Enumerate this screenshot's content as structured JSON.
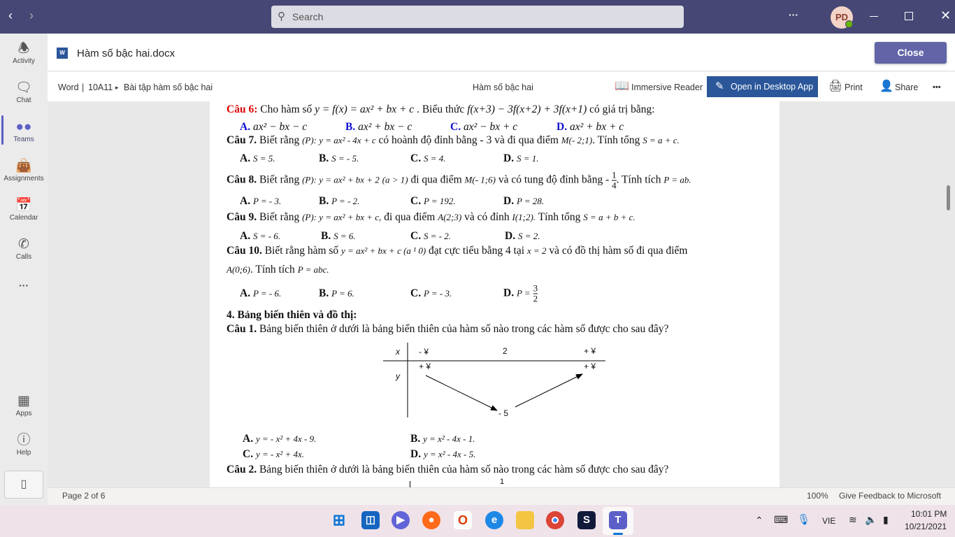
{
  "titlebar": {
    "search_placeholder": "Search",
    "more": "···",
    "avatar_initials": "PD"
  },
  "sidebar": {
    "items": [
      {
        "label": "Activity",
        "icon": "bell-icon"
      },
      {
        "label": "Chat",
        "icon": "chat-icon"
      },
      {
        "label": "Teams",
        "icon": "teams-icon",
        "active": true
      },
      {
        "label": "Assignments",
        "icon": "backpack-icon"
      },
      {
        "label": "Calendar",
        "icon": "calendar-icon"
      },
      {
        "label": "Calls",
        "icon": "phone-icon"
      },
      {
        "label": "···",
        "icon": "more-icon"
      },
      {
        "label": "Apps",
        "icon": "apps-icon"
      },
      {
        "label": "Help",
        "icon": "help-icon"
      }
    ]
  },
  "header": {
    "doc_title": "Hàm số bậc hai.docx",
    "close": "Close"
  },
  "toolbar": {
    "app": "Word",
    "sep": "|",
    "folder": "10A11",
    "arrow": "▸",
    "file": "Bài tập hàm số bậc hai",
    "center_title": "Hàm số bậc hai",
    "immersive": "Immersive Reader",
    "open_desktop": "Open in Desktop App",
    "print": "Print",
    "share": "Share",
    "more": "•••"
  },
  "doc": {
    "q6": {
      "label": "Câu 6:",
      "text1": "Cho hàm số",
      "expr1": "y = f(x) = ax² + bx + c",
      "text2": ". Biểu thức",
      "expr2": "f(x+3) − 3f(x+2) + 3f(x+1)",
      "text3": "có giá trị bằng:"
    },
    "q6_answers": [
      {
        "k": "A.",
        "v": "ax² − bx − c"
      },
      {
        "k": "B.",
        "v": "ax² + bx − c"
      },
      {
        "k": "C.",
        "v": "ax² − bx + c"
      },
      {
        "k": "D.",
        "v": "ax² + bx + c"
      }
    ],
    "q7": {
      "label": "Câu 7.",
      "text1": "Biết rằng",
      "expr1": "(P): y = ax² - 4x + c",
      "text2": "có hoành độ đỉnh bằng - 3 và đi qua điểm",
      "expr2": "M(- 2;1)",
      "text3": ". Tính tổng",
      "expr3": "S = a + c."
    },
    "q7_answers": [
      {
        "k": "A.",
        "v": "S = 5."
      },
      {
        "k": "B.",
        "v": "S = - 5."
      },
      {
        "k": "C.",
        "v": "S = 4."
      },
      {
        "k": "D.",
        "v": "S = 1."
      }
    ],
    "q8": {
      "label": "Câu 8.",
      "text1": "Biết rằng",
      "expr1": "(P): y = ax² + bx + 2",
      "expr2": "(a > 1)",
      "text2": "đi qua điểm",
      "expr3": "M(- 1;6)",
      "text3": "và có tung độ đỉnh bằng -",
      "frac_num": "1",
      "frac_den": "4",
      "text4": ". Tính tích",
      "expr4": "P = ab."
    },
    "q8_answers": [
      {
        "k": "A.",
        "v": "P = - 3."
      },
      {
        "k": "B.",
        "v": "P = - 2."
      },
      {
        "k": "C.",
        "v": "P = 192."
      },
      {
        "k": "D.",
        "v": "P = 28."
      }
    ],
    "q9": {
      "label": "Câu 9.",
      "text1": "Biết rằng",
      "expr1": "(P): y = ax² + bx + c,",
      "text2": "đi qua điểm",
      "expr2": "A(2;3)",
      "text3": "và có đỉnh",
      "expr3": "I(1;2).",
      "text4": "Tính tổng",
      "expr4": "S = a + b + c."
    },
    "q9_answers": [
      {
        "k": "A.",
        "v": "S = - 6."
      },
      {
        "k": "B.",
        "v": "S = 6."
      },
      {
        "k": "C.",
        "v": "S = - 2."
      },
      {
        "k": "D.",
        "v": "S = 2."
      }
    ],
    "q10": {
      "label": "Câu 10.",
      "text1": "Biết rằng hàm số",
      "expr1": "y = ax² + bx + c  (a ¹ 0)",
      "text2": "đạt cực tiểu bằng 4  tại",
      "expr2": "x = 2",
      "text3": "và có đồ thị hàm số đi qua điểm",
      "expr3": "A(0;6)",
      "text4": ". Tính tích",
      "expr4": "P = abc."
    },
    "q10_answers": [
      {
        "k": "A.",
        "v": "P = - 6."
      },
      {
        "k": "B.",
        "v": "P = 6."
      },
      {
        "k": "C.",
        "v": "P = - 3."
      },
      {
        "k": "D.",
        "v": "P =",
        "frac_num": "3",
        "frac_den": "2"
      }
    ],
    "section4": "4. Bảng biến thiên và đồ thị:",
    "s4q1": {
      "label": "Câu 1.",
      "text": "Bảng biến thiên ở dưới là bảng biến thiên của hàm số nào trong các hàm số được cho sau đây?"
    },
    "table1": {
      "x": "x",
      "y": "y",
      "x_left": "- ¥",
      "x_mid": "2",
      "x_right": "+ ¥",
      "y_left": "+ ¥",
      "y_right": "+ ¥",
      "y_min": "- 5"
    },
    "s4q1_answers": [
      {
        "k": "A.",
        "v": "y = - x² + 4x - 9."
      },
      {
        "k": "B.",
        "v": "y = x² - 4x - 1."
      },
      {
        "k": "C.",
        "v": "y = - x² + 4x."
      },
      {
        "k": "D.",
        "v": "y = x² - 4x - 5."
      }
    ],
    "s4q2": {
      "label": "Câu 2.",
      "text": "Bảng biến thiên ở dưới là bảng biến thiên của hàm số nào trong các hàm số được cho sau đây?"
    },
    "table2_peek": "1"
  },
  "status": {
    "page": "Page 2 of 6",
    "zoom": "100%",
    "feedback": "Give Feedback to Microsoft"
  },
  "taskbar": {
    "lang": "VIE",
    "time": "10:01 PM",
    "date": "10/21/2021"
  },
  "colors": {
    "titlebar": "#464775",
    "accent": "#6264a7",
    "word_blue": "#2b579a",
    "question_red": "#e00000",
    "answer_blue": "#1010d0"
  }
}
